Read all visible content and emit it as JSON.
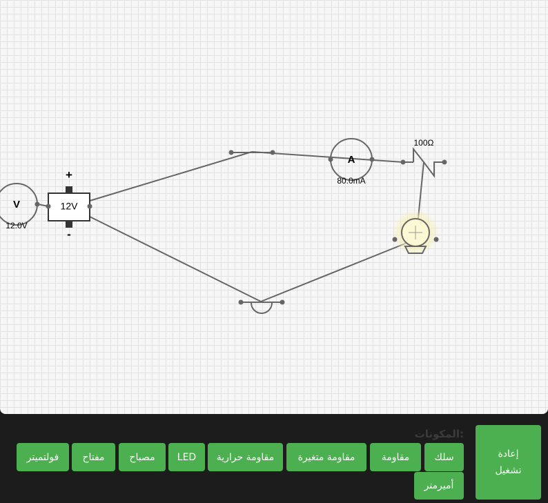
{
  "circuit": {
    "battery": {
      "label": "12V",
      "plus": "+",
      "minus": "-"
    },
    "voltmeter": {
      "symbol": "V",
      "reading": "12.0V"
    },
    "ammeter": {
      "symbol": "A",
      "reading": "80.0mA"
    },
    "variable_resistor": {
      "label": "100Ω"
    }
  },
  "toolbar": {
    "components_title": "المكونات:",
    "reset_line1": "إعادة",
    "reset_line2": "تشغيل",
    "buttons": {
      "wire": "سلك",
      "resistor": "مقاومة",
      "variable_resistor": "مقاومة متغيرة",
      "thermistor": "مقاومة حرارية",
      "led": "LED",
      "lamp": "مصباح",
      "switch": "مفتاح",
      "voltmeter": "فولتميتر",
      "ammeter": "أميرمتر"
    }
  },
  "colors": {
    "accent": "#4caf50",
    "toolbar_bg": "#1c1c1c",
    "wire": "#666666",
    "lamp_glow": "#f5f0b4"
  }
}
